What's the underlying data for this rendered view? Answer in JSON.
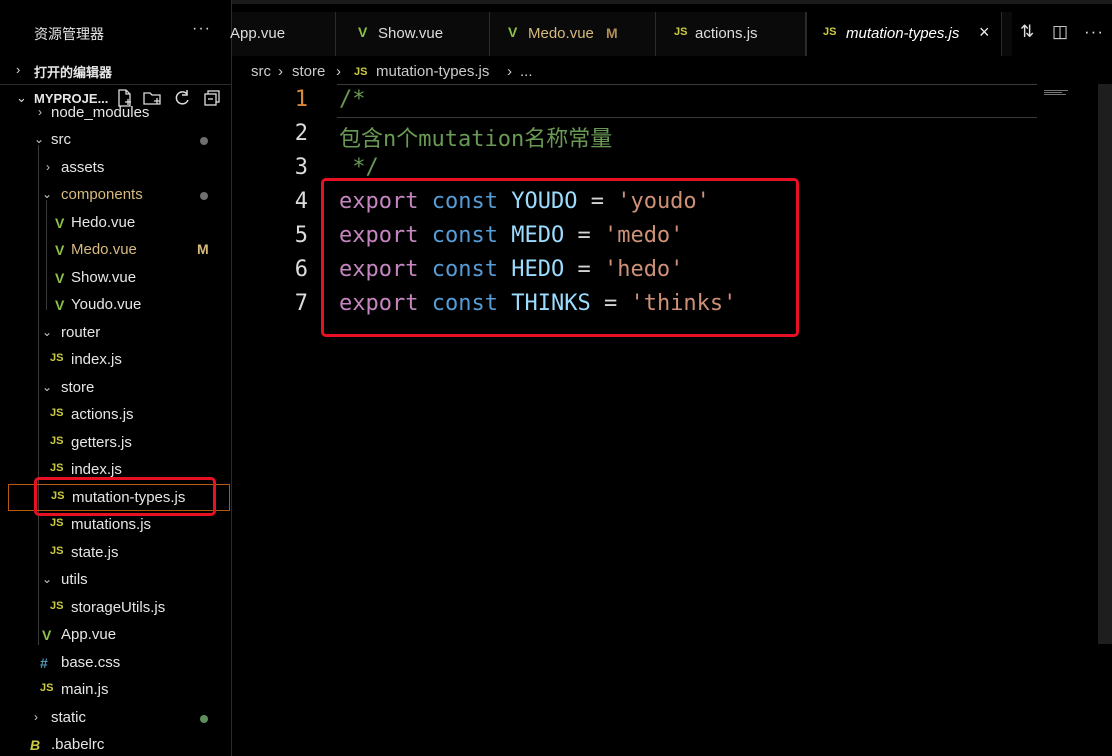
{
  "sidebar": {
    "title": "资源管理器",
    "more": "···",
    "open_editors": "打开的编辑器",
    "project": "MYPROJE...",
    "tree": [
      {
        "name": "node_modules",
        "kind": "folder",
        "chev": "›"
      },
      {
        "name": "src",
        "kind": "folder",
        "chev": "⌄",
        "dot": true
      },
      {
        "name": "assets",
        "kind": "folder",
        "chev": "›"
      },
      {
        "name": "components",
        "kind": "folder",
        "chev": "⌄",
        "dot": true
      },
      {
        "name": "Hedo.vue",
        "kind": "vue"
      },
      {
        "name": "Medo.vue",
        "kind": "vue",
        "badge": "M"
      },
      {
        "name": "Show.vue",
        "kind": "vue"
      },
      {
        "name": "Youdo.vue",
        "kind": "vue"
      },
      {
        "name": "router",
        "kind": "folder",
        "chev": "⌄"
      },
      {
        "name": "index.js",
        "kind": "js"
      },
      {
        "name": "store",
        "kind": "folder",
        "chev": "⌄"
      },
      {
        "name": "actions.js",
        "kind": "js"
      },
      {
        "name": "getters.js",
        "kind": "js"
      },
      {
        "name": "index.js",
        "kind": "js"
      },
      {
        "name": "mutation-types.js",
        "kind": "js",
        "selected": true
      },
      {
        "name": "mutations.js",
        "kind": "js"
      },
      {
        "name": "state.js",
        "kind": "js"
      },
      {
        "name": "utils",
        "kind": "folder",
        "chev": "⌄"
      },
      {
        "name": "storageUtils.js",
        "kind": "js"
      },
      {
        "name": "App.vue",
        "kind": "vue"
      },
      {
        "name": "base.css",
        "kind": "css"
      },
      {
        "name": "main.js",
        "kind": "js"
      },
      {
        "name": "static",
        "kind": "folder",
        "chev": "›",
        "dot": true
      },
      {
        "name": ".babelrc",
        "kind": "babel"
      }
    ]
  },
  "icons": {
    "js": "JS",
    "vue": "V",
    "css": "#",
    "babel": "B"
  },
  "tabs": [
    {
      "label": "App.vue",
      "icon": "",
      "modified": ""
    },
    {
      "label": "Show.vue",
      "icon": "V",
      "modified": ""
    },
    {
      "label": "Medo.vue",
      "icon": "V",
      "modified": "M"
    },
    {
      "label": "actions.js",
      "icon": "JS",
      "modified": ""
    },
    {
      "label": "mutation-types.js",
      "icon": "JS",
      "modified": "",
      "active": true
    }
  ],
  "breadcrumb": {
    "seg1": "src",
    "seg2": "store",
    "seg3_icon": "JS",
    "seg3": "mutation-types.js",
    "seg4": "..."
  },
  "editor": {
    "line_numbers": [
      "1",
      "2",
      "3",
      "4",
      "5",
      "6",
      "7"
    ],
    "comment_open": "/*",
    "comment_text": "包含n个mutation名称常量",
    "comment_close": " */",
    "consts": [
      {
        "name": "YOUDO",
        "value": "'youdo'"
      },
      {
        "name": "MEDO",
        "value": "'medo'"
      },
      {
        "name": "HEDO",
        "value": "'hedo'"
      },
      {
        "name": "THINKS",
        "value": "'thinks'"
      }
    ],
    "kw_export": "export",
    "kw_const": "const",
    "eq": "="
  },
  "colors": {
    "modified_dot": "#6a8a5a",
    "highlight": "#e81123"
  }
}
